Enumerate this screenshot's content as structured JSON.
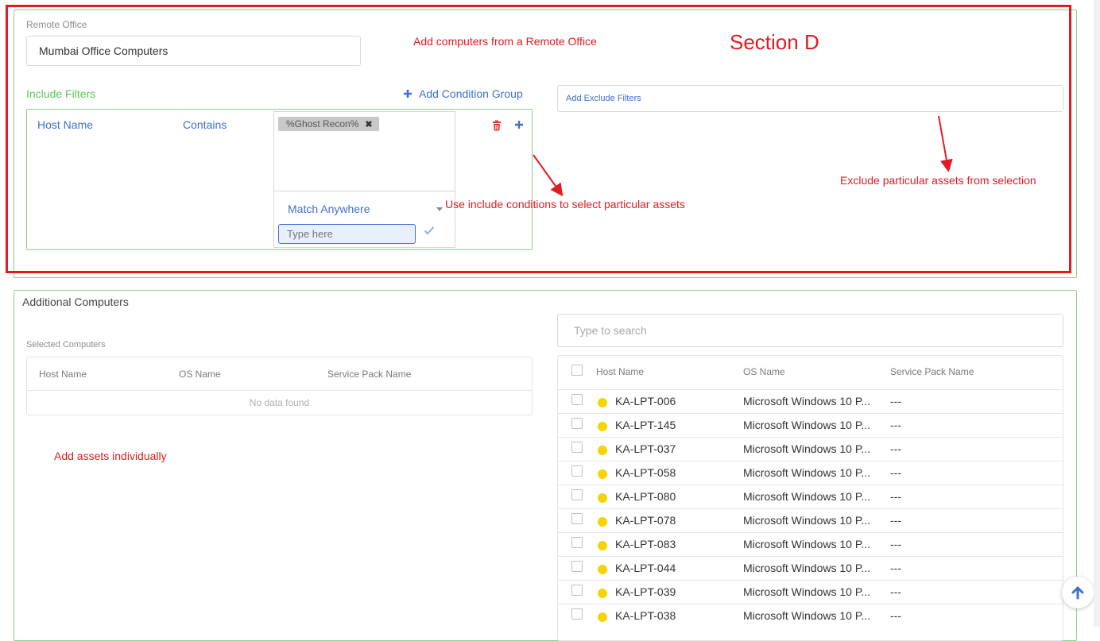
{
  "remote_office": {
    "label": "Remote Office",
    "value": "Mumbai Office Computers"
  },
  "include_filters": {
    "title": "Include Filters",
    "add_group_label": "Add Condition Group",
    "condition": {
      "field": "Host Name",
      "operator": "Contains",
      "chip": "%Ghost Recon%",
      "match_mode": "Match Anywhere",
      "input_placeholder": "Type here"
    }
  },
  "exclude_filters": {
    "placeholder": "Add Exclude Filters"
  },
  "annotations": {
    "section": "Section D",
    "remote_office": "Add computers from a Remote Office",
    "include": "Use include conditions to select particular assets",
    "exclude": "Exclude particular assets from selection",
    "individual": "Add assets individually"
  },
  "additional": {
    "title": "Additional Computers",
    "selected_label": "Selected Computers",
    "selected_columns": [
      "Host Name",
      "OS Name",
      "Service Pack Name"
    ],
    "empty_text": "No data found",
    "search_placeholder": "Type to search",
    "columns": [
      "Host Name",
      "OS Name",
      "Service Pack Name"
    ],
    "rows": [
      {
        "host": "KA-LPT-006",
        "os": "Microsoft Windows 10 P...",
        "sp": "---"
      },
      {
        "host": "KA-LPT-145",
        "os": "Microsoft Windows 10 P...",
        "sp": "---"
      },
      {
        "host": "KA-LPT-037",
        "os": "Microsoft Windows 10 P...",
        "sp": "---"
      },
      {
        "host": "KA-LPT-058",
        "os": "Microsoft Windows 10 P...",
        "sp": "---"
      },
      {
        "host": "KA-LPT-080",
        "os": "Microsoft Windows 10 P...",
        "sp": "---"
      },
      {
        "host": "KA-LPT-078",
        "os": "Microsoft Windows 10 P...",
        "sp": "---"
      },
      {
        "host": "KA-LPT-083",
        "os": "Microsoft Windows 10 P...",
        "sp": "---"
      },
      {
        "host": "KA-LPT-044",
        "os": "Microsoft Windows 10 P...",
        "sp": "---"
      },
      {
        "host": "KA-LPT-039",
        "os": "Microsoft Windows 10 P...",
        "sp": "---"
      },
      {
        "host": "KA-LPT-038",
        "os": "Microsoft Windows 10 P...",
        "sp": "---"
      }
    ]
  },
  "colors": {
    "panel_border": "#8ed08e",
    "annotation_red": "#e11b22",
    "link_blue": "#3f6fd1",
    "status_yellow": "#f5d400",
    "include_green": "#5cc45c"
  }
}
